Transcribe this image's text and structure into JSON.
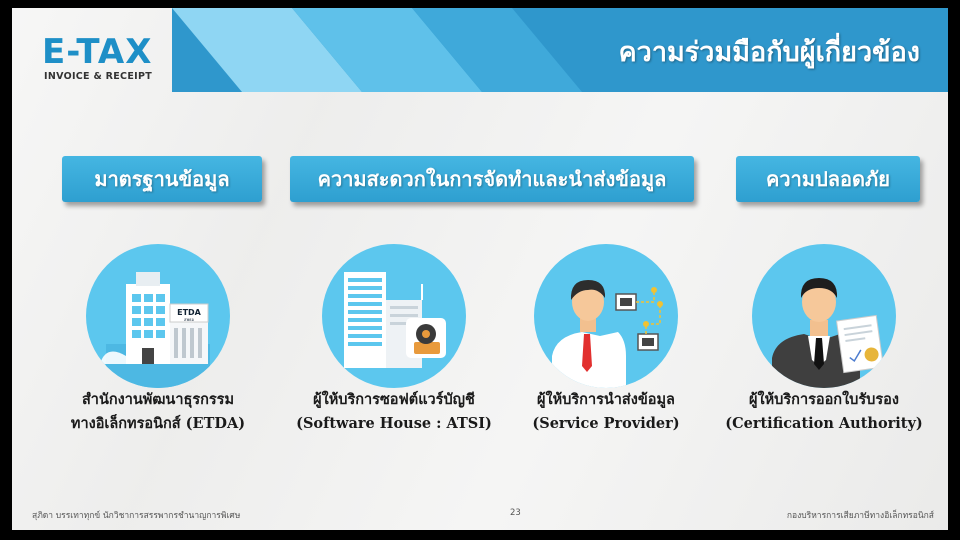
{
  "logo": {
    "word": "E-TAX",
    "subtitle": "INVOICE & RECEIPT"
  },
  "header": {
    "title": "ความร่วมมือกับผู้เกี่ยวข้อง"
  },
  "categories": [
    {
      "label": "มาตรฐานข้อมูล"
    },
    {
      "label": "ความสะดวกในการจัดทำและนำส่งข้อมูล"
    },
    {
      "label": "ความปลอดภัย"
    }
  ],
  "entities": [
    {
      "icon": "building-icon",
      "line1": "สำนักงานพัฒนาธุรกรรม",
      "line2": "ทางอิเล็กทรอนิกส์ (ETDA)",
      "sign": "ETDA",
      "sign_sub": "สพธอ"
    },
    {
      "icon": "software-house-icon",
      "line1": "ผู้ให้บริการซอฟต์แวร์บัญชี",
      "line2": "(Software House : ATSI)"
    },
    {
      "icon": "service-provider-icon",
      "line1": "ผู้ให้บริการนำส่งข้อมูล",
      "line2": "(Service Provider)"
    },
    {
      "icon": "certificate-authority-icon",
      "line1": "ผู้ให้บริการออกใบรับรอง",
      "line2": "(Certification Authority)"
    }
  ],
  "footer": {
    "presenter": "สุภิดา บรรเทาทุกข์   นักวิชาการสรรพากรชำนาญการพิเศษ",
    "page": "23",
    "department": "กองบริหารการเสียภาษีทางอิเล็กทรอนิกส์"
  },
  "colors": {
    "accent": "#2e9fd0",
    "circle": "#5cc7ee",
    "header_dark": "#2a90c4"
  }
}
